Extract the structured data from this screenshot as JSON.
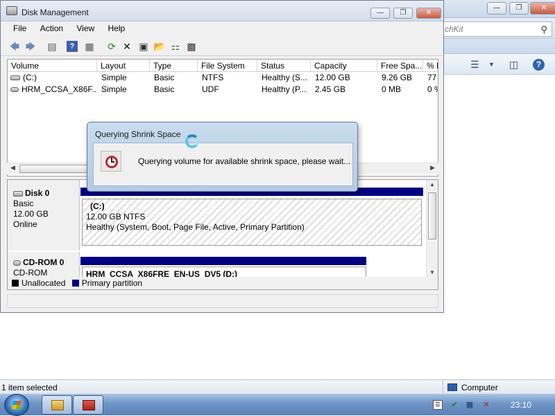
{
  "background_window": {
    "search_placeholder": "chKit",
    "search_icon": "magnifier-icon"
  },
  "disk_management": {
    "title": "Disk Management",
    "menu": [
      {
        "label": "File"
      },
      {
        "label": "Action"
      },
      {
        "label": "View"
      },
      {
        "label": "Help"
      }
    ],
    "columns": [
      "Volume",
      "Layout",
      "Type",
      "File System",
      "Status",
      "Capacity",
      "Free Spa...",
      "% F"
    ],
    "volumes": [
      {
        "volume": "(C:)",
        "layout": "Simple",
        "type": "Basic",
        "file_system": "NTFS",
        "status": "Healthy (S...",
        "capacity": "12.00 GB",
        "free_space": "9.26 GB",
        "percent_free": "77"
      },
      {
        "volume": "HRM_CCSA_X86F...",
        "layout": "Simple",
        "type": "Basic",
        "file_system": "UDF",
        "status": "Healthy (P...",
        "capacity": "2.45 GB",
        "free_space": "0 MB",
        "percent_free": "0 %"
      }
    ],
    "disks": [
      {
        "name": "Disk 0",
        "type": "Basic",
        "size": "12.00 GB",
        "state": "Online",
        "partition": {
          "name": "(C:)",
          "size_fs": "12.00 GB NTFS",
          "status": "Healthy (System, Boot, Page File, Active, Primary Partition)"
        }
      },
      {
        "name": "CD-ROM 0",
        "type": "CD-ROM",
        "partition": {
          "name": "HRM_CCSA_X86FRE_EN-US_DV5  (D:)"
        }
      }
    ],
    "legend": [
      {
        "label": "Unallocated",
        "color": "#000000"
      },
      {
        "label": "Primary partition",
        "color": "#000080"
      }
    ]
  },
  "dialog": {
    "title": "Querying Shrink Space",
    "message": "Querying volume for available shrink space, please wait..."
  },
  "explorer_status": {
    "selection": "1 item selected",
    "location": "Computer"
  },
  "taskbar": {
    "clock": "23:10"
  }
}
